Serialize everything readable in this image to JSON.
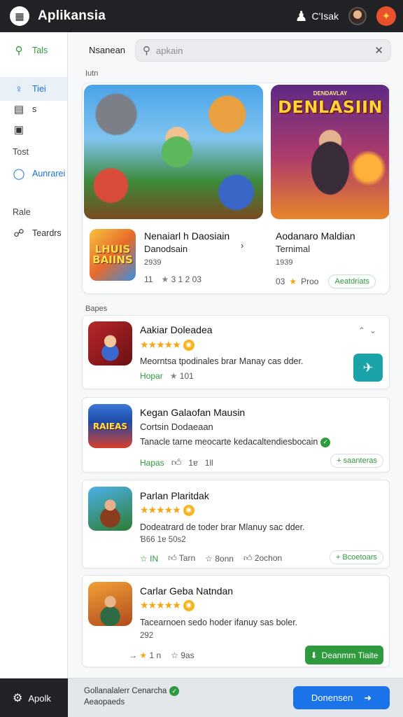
{
  "app": {
    "title": "Aplikansia",
    "logo_icon": "grid-icon"
  },
  "topbar": {
    "user_label": "C'Isak",
    "user_icon": "chess-pawn-icon"
  },
  "sidebar": {
    "items": [
      {
        "label": "Tals",
        "icon": "search-icon"
      },
      {
        "label": "Tiei",
        "icon": "lightbulb-icon"
      },
      {
        "label": "s",
        "icon": "calendar-icon"
      },
      {
        "label": "",
        "icon": "image-icon"
      }
    ],
    "section_lost": "Tost",
    "lost_item": {
      "label": "Aunrarei",
      "icon": "circle-icon"
    },
    "section_rale": "Rale",
    "rale_item": {
      "label": "Teardrs",
      "icon": "group-icon"
    }
  },
  "main": {
    "headline": "Nsanean",
    "search": {
      "placeholder": "apkain"
    },
    "section1": "Iutn",
    "section2": "Bapes"
  },
  "featured": {
    "banner_kicker": "DENDAVLAY",
    "banner_title": "DENLASIIN",
    "icon_text": "LHUIS BAIINS",
    "left": {
      "title": "Nenaiarl h Daosiain",
      "subtitle": "Danodsain",
      "year": "2939",
      "count": "11",
      "rating": "3  1 2 03"
    },
    "right": {
      "title": "Aodanaro Maldian",
      "subtitle": "Ternimal",
      "year": "1939",
      "count": "03",
      "rating_label": "Proo",
      "pill": "Aeatdriats"
    }
  },
  "games": [
    {
      "title": "Aakiar Doleadea",
      "desc": "Meorntsa tpodinales brar Manay cas dder.",
      "tag": "Hopar",
      "stat": "101"
    },
    {
      "title": "Kegan Galaofan Mausin",
      "subtitle": "Cortsin Dodaeaan",
      "desc": "Tanacle tarne meocarte kedacaltendiesbocain",
      "tag": "Hapas",
      "stat1": "1ɐ",
      "stat2": "1ll",
      "pill": "+ saanteras",
      "icon_text": "RAIEAS"
    },
    {
      "title": "Parlan Plaritdak",
      "desc": "Dodeatrard de toder brar Mlanuy sac dder.",
      "line3": "Ɓ66 1ɐ 50s2",
      "tag": "IN",
      "stat1": "Tarn",
      "stat2": "8onn",
      "stat3": "2ochon",
      "pill": "+ Bcoetoars"
    },
    {
      "title": "Carlar Geba Natndan",
      "desc": "Tacearnoen sedo hoder ifanuy sas boler.",
      "line3": "292",
      "stat1": "1 n",
      "stat2": "9as",
      "button": "Deanmm Tiaite"
    }
  ],
  "bottombar": {
    "app_label": "Apolk",
    "status_line1": "Gollanalalerr Cenarcha",
    "status_line2": "Aeaopaeds",
    "button_label": "Donensen"
  }
}
